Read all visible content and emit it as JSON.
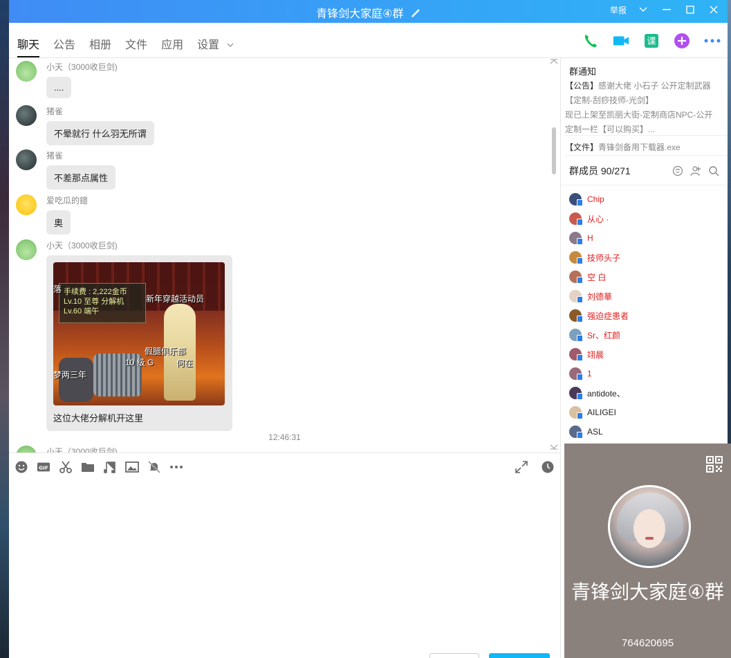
{
  "titlebar": {
    "title": "青锋剑大家庭④群",
    "report": "举报"
  },
  "tabs": [
    {
      "label": "聊天",
      "active": true
    },
    {
      "label": "公告"
    },
    {
      "label": "相册"
    },
    {
      "label": "文件"
    },
    {
      "label": "应用"
    },
    {
      "label": "设置"
    }
  ],
  "header_tools": [
    "phone-icon",
    "video-icon",
    "lesson-icon",
    "plus-icon",
    "more-icon"
  ],
  "lesson_label": "课",
  "messages": [
    {
      "sender": "小天（3000收巨剑)",
      "text": "...."
    },
    {
      "sender": "猪雀",
      "text": "不晕就行 什么羽无所谓"
    },
    {
      "sender": "猪雀",
      "text": "不差那点属性"
    },
    {
      "sender": "爱吃瓜的鐿",
      "text": "奥"
    },
    {
      "sender": "小天（3000收巨剑)",
      "caption": "这位大佬分解机开这里"
    },
    {
      "sender": "小天（3000收巨剑)"
    }
  ],
  "game_image": {
    "panel_line1": "手续费 : 2,222金币",
    "panel_line2": "Lv.10 至尊 分解机",
    "panel_line3": "Lv.60 端午",
    "label_npc": "新年穿越活动员",
    "label_club": "假腿俱乐部",
    "label_bottom": "梦两三年",
    "label_level": "10 级 G",
    "label_where": "何在",
    "label_left": "落"
  },
  "timestamp": "12:46:31",
  "input_tools": [
    "emoji-icon",
    "gif-icon",
    "scissors-icon",
    "folder-icon",
    "music-icon",
    "image-icon",
    "bell-off-icon",
    "more-icon"
  ],
  "input_right_tools": [
    "expand-icon",
    "history-icon"
  ],
  "notice": {
    "title": "群通知",
    "tag": "【公告】",
    "text1": "感谢大佬 小石子 公开定制武器",
    "text2": "【定制-刮痧技师-光剑】",
    "text3": "现已上架至凯丽大街-定制商店NPC-公开",
    "text4": "定制一栏【可以购买】..."
  },
  "file": {
    "tag": "【文件】",
    "name": "青锋剑备用下载器.exe"
  },
  "members": {
    "title": "群成员 90/271",
    "list": [
      {
        "name": "Chip",
        "color": "red"
      },
      {
        "name": "从心 ·",
        "color": "red"
      },
      {
        "name": "H",
        "color": "red"
      },
      {
        "name": "技师头子",
        "color": "red"
      },
      {
        "name": "空 白",
        "color": "red"
      },
      {
        "name": "刘德華",
        "color": "red"
      },
      {
        "name": "强迫症患者",
        "color": "red"
      },
      {
        "name": "Sr、红颜",
        "color": "red"
      },
      {
        "name": "翊晨",
        "color": "red"
      },
      {
        "name": "1",
        "color": "red"
      },
      {
        "name": "antidote、",
        "color": "black"
      },
      {
        "name": "AILIGEI",
        "color": "black"
      },
      {
        "name": "ASL",
        "color": "black"
      }
    ]
  },
  "card": {
    "name": "青锋剑大家庭④群",
    "id": "764620695"
  },
  "colors": {
    "titlebar_start": "#3f8cf5",
    "titlebar_end": "#2fb4f6",
    "bubble": "#e9e9e9",
    "member_red": "#e02020",
    "card_bg": "#8a807c",
    "send_button": "#12b7f5"
  }
}
